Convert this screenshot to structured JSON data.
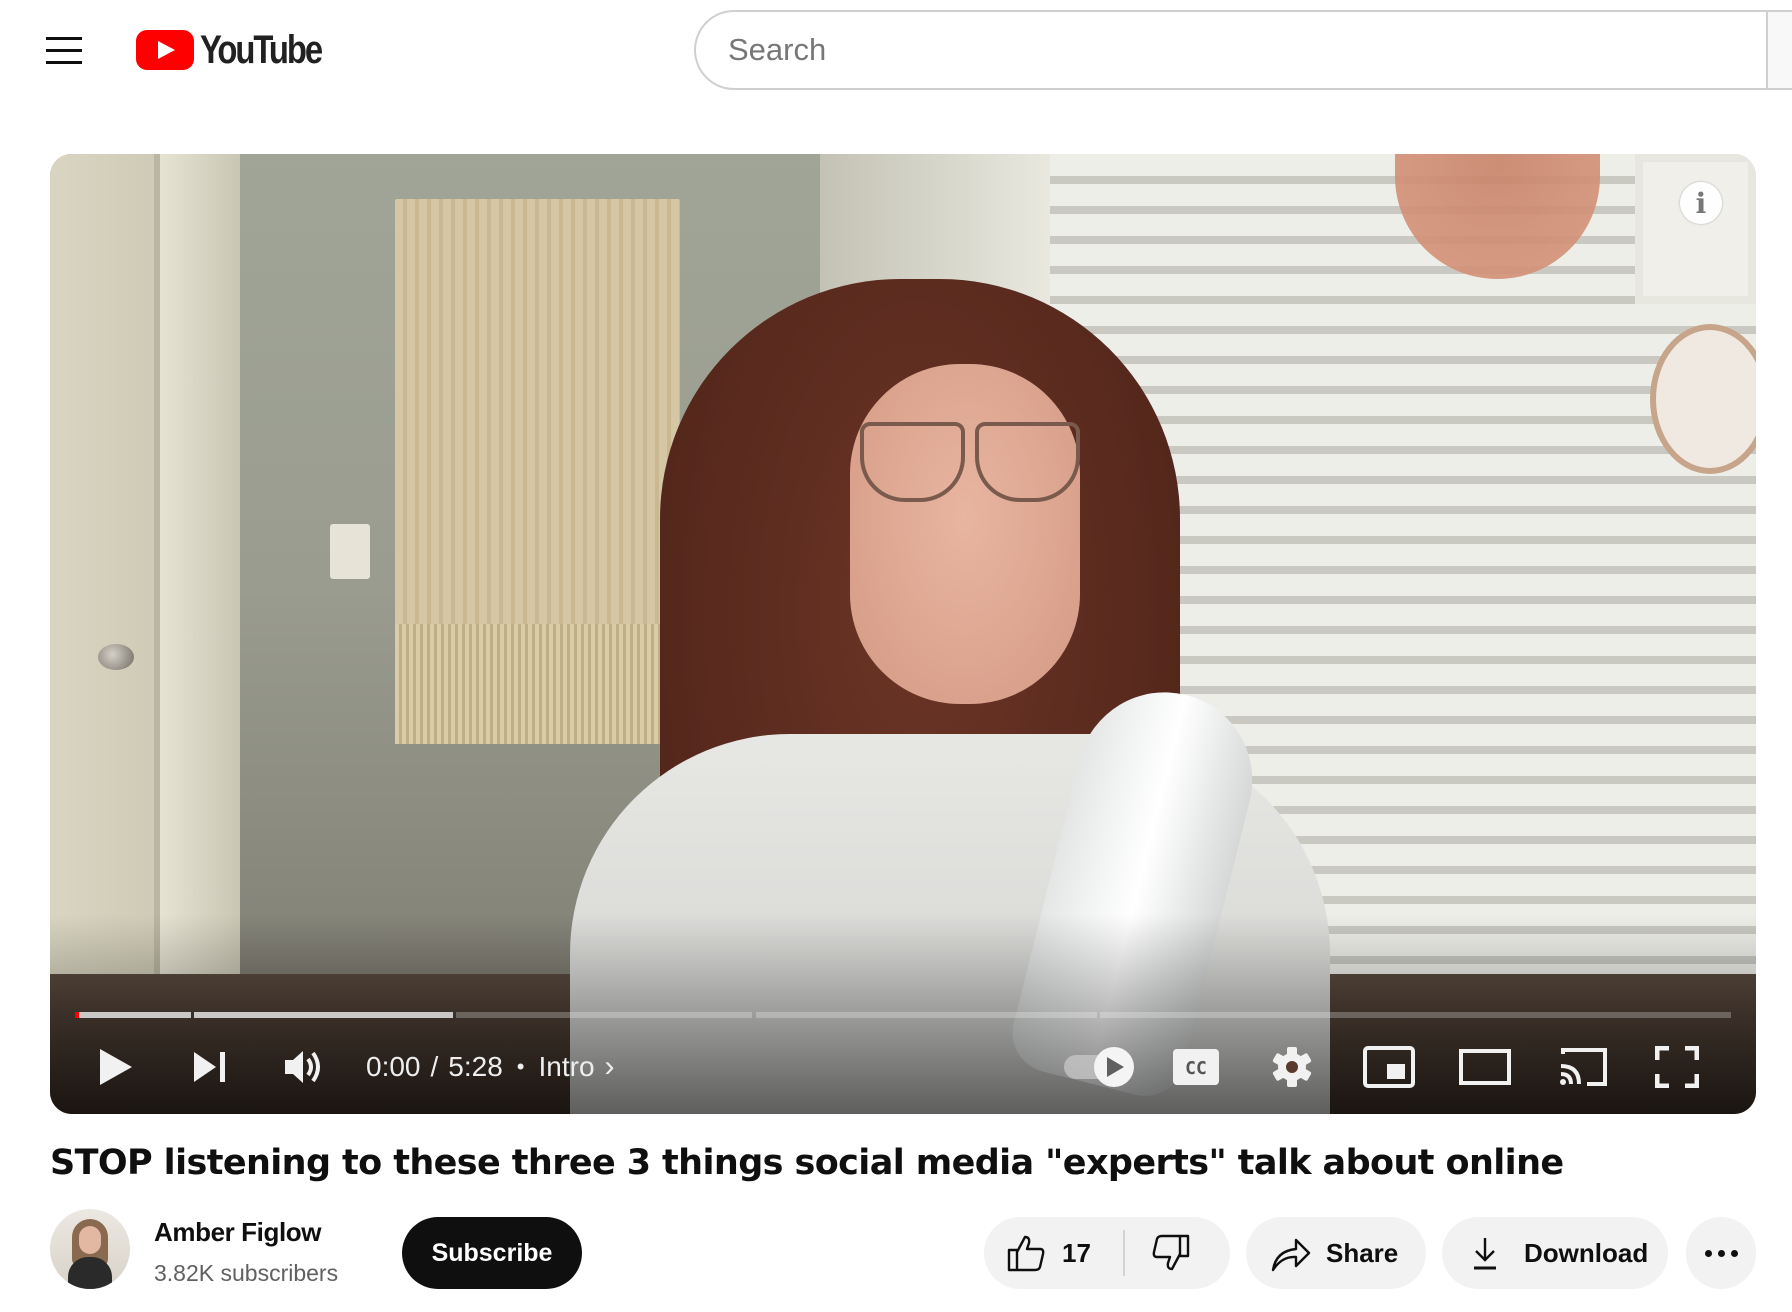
{
  "header": {
    "menu_icon": "hamburger-menu-icon",
    "logo_text": "YouTube",
    "search": {
      "placeholder": "Search",
      "value": ""
    }
  },
  "player": {
    "info_icon_label": "i",
    "progress": {
      "current_fraction": 0.0,
      "chapters": [
        {
          "start_fraction": 0.0,
          "end_fraction": 0.07,
          "loaded_fraction": 1.0
        },
        {
          "start_fraction": 0.072,
          "end_fraction": 0.228,
          "loaded_fraction": 1.0
        },
        {
          "start_fraction": 0.23,
          "end_fraction": 0.409,
          "loaded_fraction": 0.0
        },
        {
          "start_fraction": 0.411,
          "end_fraction": 0.617,
          "loaded_fraction": 0.0
        },
        {
          "start_fraction": 0.619,
          "end_fraction": 1.0,
          "loaded_fraction": 0.0
        }
      ],
      "buffered_until_fraction": 0.228
    },
    "controls": {
      "current_time": "0:00",
      "separator": "/",
      "duration": "5:28",
      "dot": "•",
      "chapter_name": "Intro",
      "chevron": "›",
      "autoplay_on": true,
      "cc_label": "CC"
    }
  },
  "video": {
    "title": "STOP listening to these three 3 things social media \"experts\" talk about online"
  },
  "channel": {
    "name": "Amber Figlow",
    "subscribers": "3.82K subscribers",
    "subscribe_label": "Subscribe"
  },
  "actions": {
    "like_count": "17",
    "share_label": "Share",
    "download_label": "Download"
  },
  "colors": {
    "brand_red": "#ff0000",
    "subscribe_bg": "#0f0f0f",
    "pill_bg": "#f2f2f2",
    "text_secondary": "#606060"
  }
}
